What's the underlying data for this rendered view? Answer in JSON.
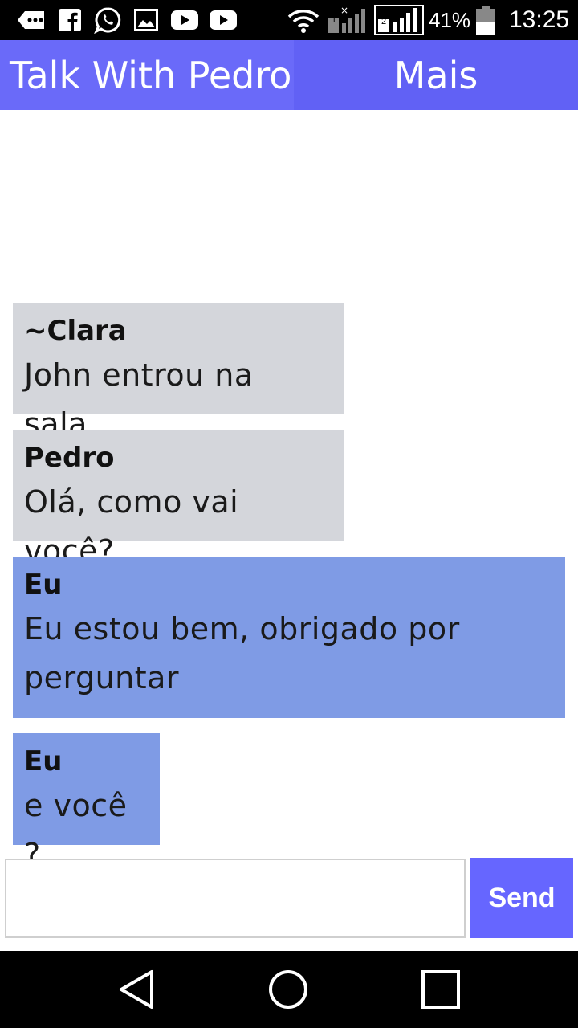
{
  "status_bar": {
    "battery_percent": "41%",
    "time": "13:25",
    "sim1_label": "1",
    "sim2_label": "2",
    "icons": [
      "more-icon",
      "facebook-icon",
      "whatsapp-icon",
      "gallery-icon",
      "youtube-icon",
      "youtube-icon",
      "wifi-icon",
      "signal-sim1-icon",
      "signal-sim2-icon",
      "battery-icon"
    ]
  },
  "app_bar": {
    "title": "Talk With Pedro",
    "menu_label": "Mais",
    "colors": {
      "title_bg": "#6a6af9",
      "bar_bg": "#6161f5"
    }
  },
  "messages": [
    {
      "sender": "~Clara",
      "text": "John entrou na sala.",
      "mine": false
    },
    {
      "sender": "Pedro",
      "text": "Olá, como vai você?",
      "mine": false
    },
    {
      "sender": "Eu",
      "text_lines": [
        "Eu estou bem, obrigado por",
        "perguntar"
      ],
      "mine": true
    },
    {
      "sender": "Eu",
      "text": "e você ?",
      "mine": true
    }
  ],
  "bubble_colors": {
    "other": "#d4d6db",
    "mine": "#7f9be5"
  },
  "composer": {
    "input_value": "",
    "input_placeholder": "",
    "send_label": "Send",
    "send_color": "#6666ff"
  },
  "nav_bar": {
    "icons": [
      "back-icon",
      "home-icon",
      "recents-icon"
    ]
  }
}
